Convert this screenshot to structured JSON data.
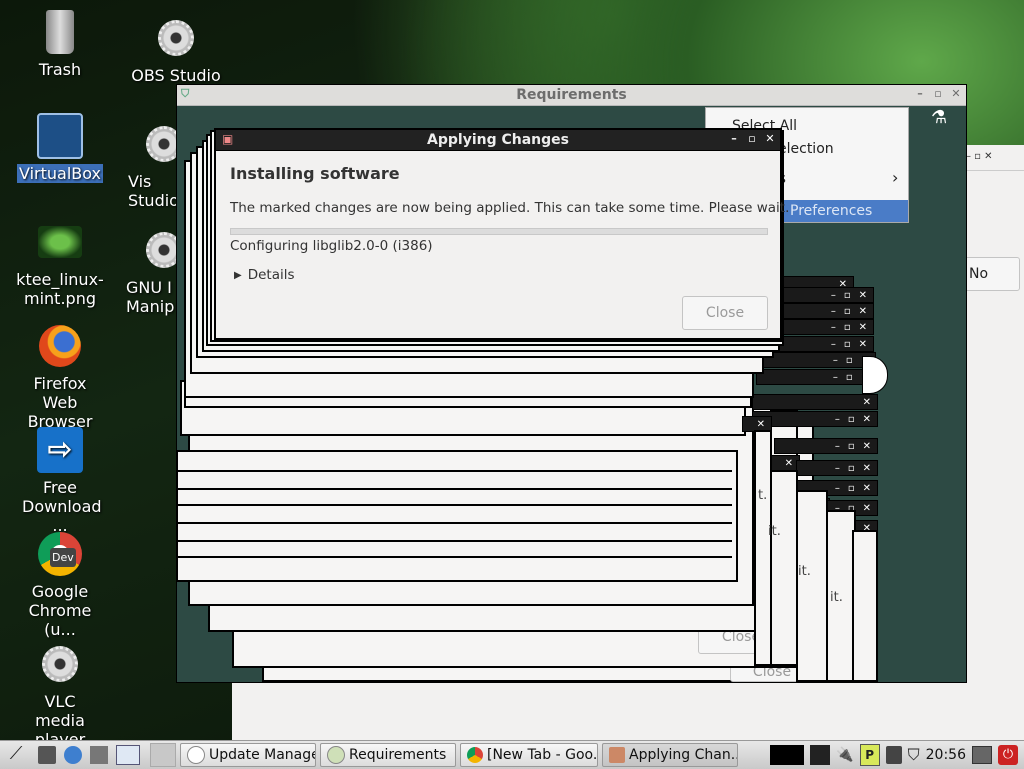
{
  "desktop": {
    "icons": [
      {
        "label": "Trash",
        "icon": "trash-icon"
      },
      {
        "label": "OBS Studio",
        "icon": "gear-icon"
      },
      {
        "label": "VirtualBox",
        "icon": "virtualbox-icon"
      },
      {
        "label": "Vis Studio",
        "icon": "gear-icon"
      },
      {
        "label": "ktee_linux-mint.png",
        "icon": "image-file-icon"
      },
      {
        "label": "GNU I Manip",
        "icon": "gear-icon"
      },
      {
        "label": "Firefox Web Browser",
        "icon": "firefox-icon"
      },
      {
        "label": "Free Download ...",
        "icon": "download-manager-icon"
      },
      {
        "label": "Google Chrome (u...",
        "icon": "chrome-dev-icon"
      },
      {
        "label": "VLC media player",
        "icon": "gear-icon"
      }
    ],
    "chrome_badge": "Dev"
  },
  "requirements_window": {
    "title": "Requirements",
    "menu_items": [
      "Select All",
      "election",
      "es",
      "Preferences"
    ],
    "side_button": "No"
  },
  "applying_dialog": {
    "title": "Applying Changes",
    "heading": "Installing software",
    "message": "The marked changes are now being applied. This can take some time. Please wait.",
    "status": "Configuring libglib2.0-0 (i386)",
    "details_label": "Details",
    "close_button": "Close",
    "progress": 0.0
  },
  "stacked_ghosts": {
    "close_labels": [
      "Close",
      "Close"
    ],
    "wait_fragments": [
      "t.",
      "it.",
      "it.",
      "it."
    ]
  },
  "taskbar": {
    "tasks": [
      "Update Manager",
      "Requirements",
      "[New Tab - Goo...",
      "Applying Chan..."
    ],
    "clock": "20:56"
  }
}
